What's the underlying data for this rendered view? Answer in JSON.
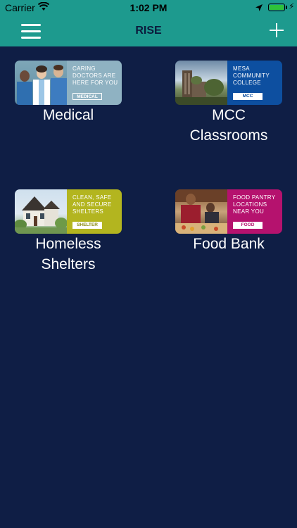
{
  "status": {
    "carrier": "Carrier",
    "time": "1:02 PM",
    "battery_level": 1.0
  },
  "nav": {
    "title": "RISE"
  },
  "colors": {
    "background": "#0f1e45",
    "bar": "#1d9a8e",
    "medical": "#8fb2c2",
    "mcc": "#0d4fa0",
    "shelter": "#b3b51f",
    "food": "#b5126e"
  },
  "tiles": [
    {
      "label_lines": [
        "Medical"
      ],
      "card_text": "CARING DOCTORS ARE HERE FOR YOU",
      "tag": "MEDICAL",
      "icon": "doctors-photo"
    },
    {
      "label_lines": [
        "MCC",
        "Classrooms"
      ],
      "card_text": "MESA COMMUNITY COLLEGE",
      "tag": "MCC",
      "icon": "campus-building-photo"
    },
    {
      "label_lines": [
        "Homeless",
        "Shelters"
      ],
      "card_text": "CLEAN, SAFE AND SECURE SHELTERS",
      "tag": "SHELTER",
      "icon": "house-photo"
    },
    {
      "label_lines": [
        "Food Bank"
      ],
      "card_text": "FOOD PANTRY LOCATIONS NEAR YOU",
      "tag": "FOOD",
      "icon": "food-pantry-photo"
    }
  ]
}
